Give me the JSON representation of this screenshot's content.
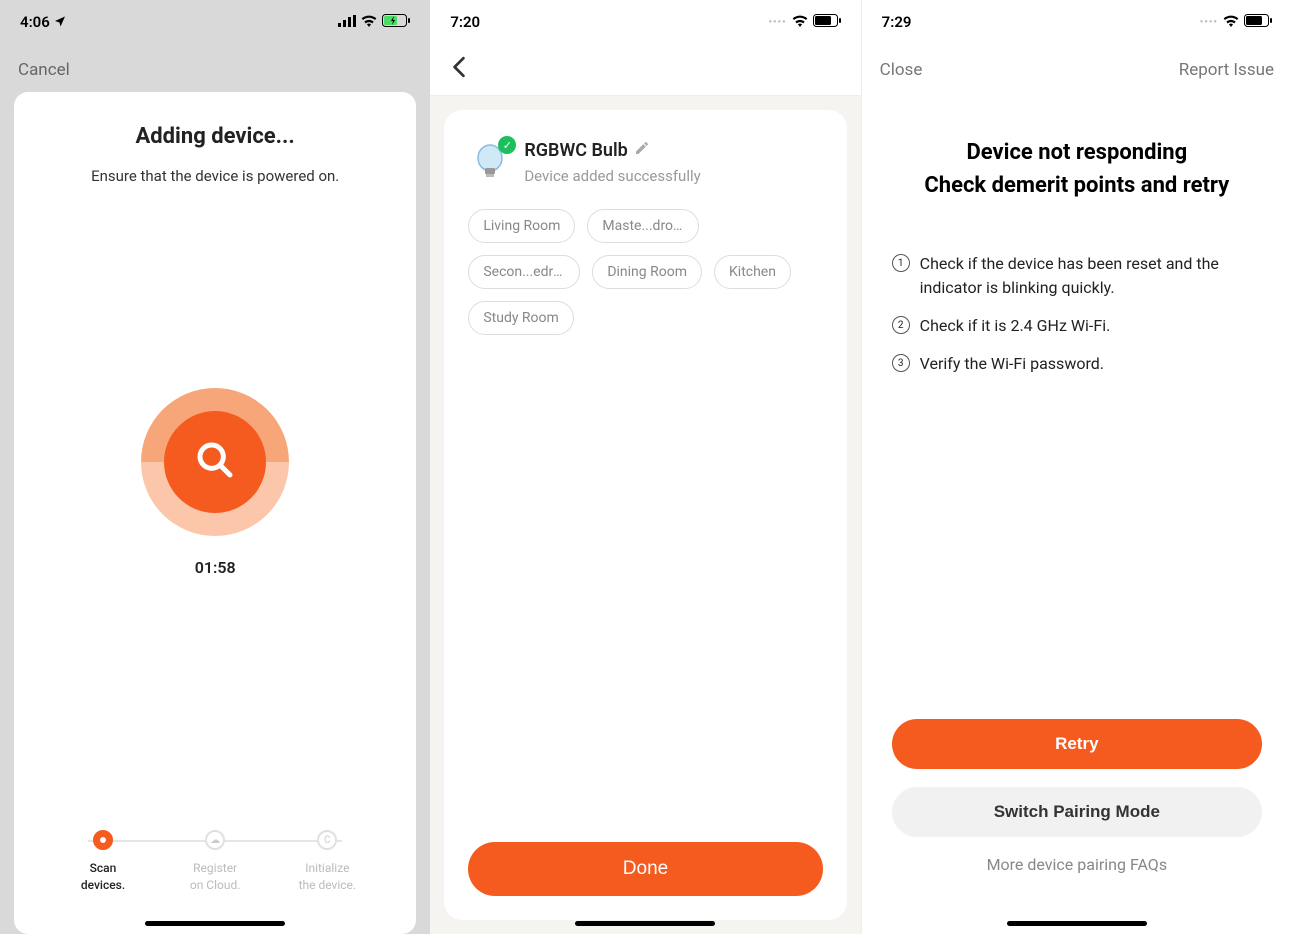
{
  "screen1": {
    "time": "4:06",
    "cancel": "Cancel",
    "title": "Adding device...",
    "subtitle": "Ensure that the device is powered on.",
    "timer": "01:58",
    "steps": [
      {
        "label": "Scan\ndevices.",
        "active": true
      },
      {
        "label": "Register\non Cloud.",
        "active": false
      },
      {
        "label": "Initialize\nthe device.",
        "active": false
      }
    ]
  },
  "screen2": {
    "time": "7:20",
    "device_name": "RGBWC Bulb",
    "device_msg": "Device added successfully",
    "rooms": [
      "Living Room",
      "Maste...droom",
      "Secon...edroom",
      "Dining Room",
      "Kitchen",
      "Study Room"
    ],
    "done": "Done"
  },
  "screen3": {
    "time": "7:29",
    "close": "Close",
    "report": "Report Issue",
    "title_line1": "Device not responding",
    "title_line2": "Check demerit points and retry",
    "checks": [
      "Check if the device has been reset and the indicator is blinking quickly.",
      "Check if it is 2.4 GHz Wi-Fi.",
      "Verify the Wi-Fi password."
    ],
    "retry": "Retry",
    "switch": "Switch Pairing Mode",
    "faq": "More device pairing FAQs"
  }
}
